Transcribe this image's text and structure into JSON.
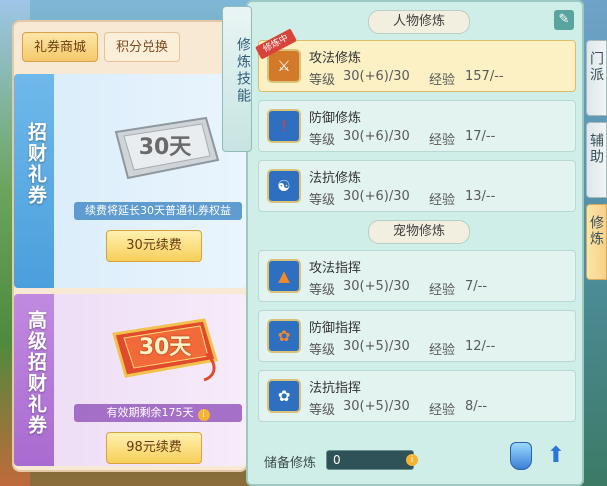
{
  "shop": {
    "tabs": [
      "礼券商城",
      "积分兑换"
    ],
    "active_tab": 0,
    "cards": [
      {
        "title": "招财礼券",
        "ticket_text": "30天",
        "note": "续费将延长30天普通礼券权益",
        "button": "30元续费",
        "note_info_icon": false
      },
      {
        "title": "高级招财礼券",
        "ticket_text": "30天",
        "note": "有效期剩余175天",
        "button": "98元续费",
        "note_info_icon": true
      }
    ]
  },
  "panel": {
    "vertical_tab": "修炼技能",
    "sections": [
      {
        "header": "人物修炼"
      },
      {
        "header": "宠物修炼"
      }
    ],
    "skills": [
      {
        "name": "攻法修炼",
        "badge": "修炼中",
        "level_label": "等级",
        "level": "30(+6)/30",
        "exp_label": "经验",
        "exp": "157/--",
        "icon": "sword-shield-icon",
        "selected": true
      },
      {
        "name": "防御修炼",
        "badge": "",
        "level_label": "等级",
        "level": "30(+6)/30",
        "exp_label": "经验",
        "exp": "17/--",
        "icon": "shield-icon",
        "selected": false
      },
      {
        "name": "法抗修炼",
        "badge": "",
        "level_label": "等级",
        "level": "30(+6)/30",
        "exp_label": "经验",
        "exp": "13/--",
        "icon": "yin-yang-icon",
        "selected": false
      },
      {
        "name": "攻法指挥",
        "badge": "",
        "level_label": "等级",
        "level": "30(+5)/30",
        "exp_label": "经验",
        "exp": "7/--",
        "icon": "pennant-icon",
        "selected": false
      },
      {
        "name": "防御指挥",
        "badge": "",
        "level_label": "等级",
        "level": "30(+5)/30",
        "exp_label": "经验",
        "exp": "12/--",
        "icon": "paw-shield-icon",
        "selected": false
      },
      {
        "name": "法抗指挥",
        "badge": "",
        "level_label": "等级",
        "level": "30(+5)/30",
        "exp_label": "经验",
        "exp": "8/--",
        "icon": "paw-icon",
        "selected": false
      }
    ],
    "reserve_label": "储备修炼",
    "reserve_value": "0"
  },
  "side_tabs": [
    {
      "label": "门派",
      "active": false
    },
    {
      "label": "辅助",
      "active": false
    },
    {
      "label": "修炼",
      "active": true
    }
  ],
  "colors": {
    "panel_bg": "#cfeee8",
    "selected_row": "#fbf1c5",
    "badge_red": "#d9433a",
    "shop_blue": "#4b9fdc",
    "shop_purple": "#a86bd0"
  }
}
